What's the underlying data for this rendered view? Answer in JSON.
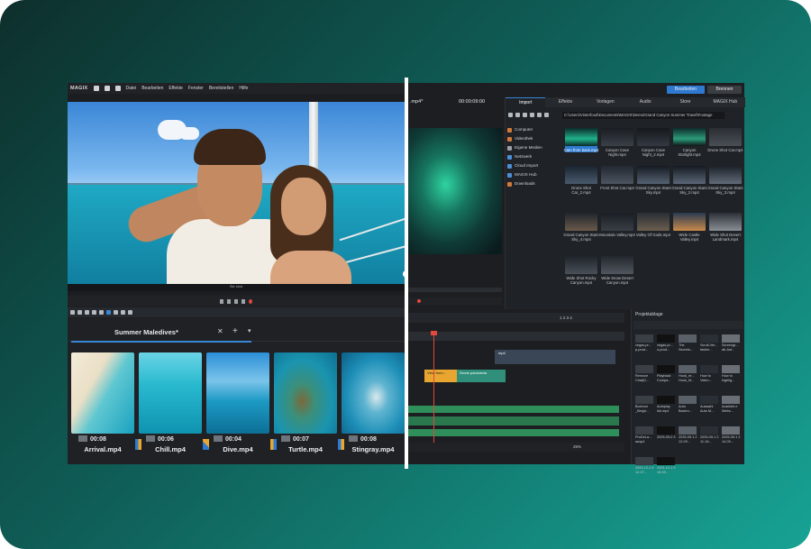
{
  "left": {
    "menu": {
      "logo": "MAGIX",
      "items": [
        "Datei",
        "Bearbeiten",
        "Effekte",
        "Fenster",
        "Bereitstellen",
        "Hilfe"
      ]
    },
    "preview_scrub_label": "Sie sind",
    "storyboard": {
      "title": "Summer Maledives*",
      "close_glyph": "✕",
      "add_glyph": "+",
      "more_glyph": "▾",
      "clips": [
        {
          "duration": "00:08",
          "name": "Arrival.mp4"
        },
        {
          "duration": "00:06",
          "name": "Chill.mp4"
        },
        {
          "duration": "00:04",
          "name": "Dive.mp4"
        },
        {
          "duration": "00:07",
          "name": "Turtle.mp4"
        },
        {
          "duration": "00:08",
          "name": "Stingray.mp4"
        }
      ]
    }
  },
  "right": {
    "buttons": {
      "edit": "Bearbeiten",
      "burn": "Brennen"
    },
    "preview": {
      "star": ".mp4*",
      "timecode": "00:00:09:00"
    },
    "tabs": [
      "Import",
      "Effekte",
      "Vorlagen",
      "Audio",
      "Store",
      "MAGIX Hub"
    ],
    "path": "C:\\Users\\Vinterfood\\Documents\\MAGIX\\Demo\\Grand Canyon Summer Travel\\Footage",
    "sources": [
      "Computer",
      "Videothek",
      "Eigene Medien",
      "Netzwerk",
      "Cloud Import",
      "MAGIX Hub",
      "Downloads"
    ],
    "media_tiles": [
      "Cam from back.mp4",
      "Canyon Cave Night.mp4",
      "Canyon Cave Night_2.mp4",
      "Canyon Starlight.mp4",
      "Drone Shot Car.mp4",
      "Drone Shot Car_2.mp4",
      "Front Shot Car.mp4",
      "Grand Canyon Stars Sky.mp4",
      "Grand Canyon Stars Sky_2.mp4",
      "Grand Canyon Stars Sky_3.mp4",
      "Grand Canyon Stars Sky_4.mp4",
      "Mountain Valley.mp4",
      "Valley Of Gods.mp4",
      "Wide Castle Valley.mp4",
      "Wide Shot Desert Landmark.mp4",
      "Wide Shot Rocky Canyon.mp4",
      "Wide Snow Desert Canyon.mp4"
    ],
    "timeline": {
      "counter": "1 2 3 4",
      "clip_labels": [
        "mp4",
        "View from...",
        "Drone panorama"
      ],
      "zoom": "25%"
    },
    "project": {
      "title": "Projektablage",
      "tiles": [
        "vegas-pr... p-prod...",
        "vegas-pr... o-prod...",
        "The Secrets...",
        "Scroll-Ver... fasher...",
        "Screengr... ab-Aut...",
        "Remove Chat(D...",
        "Playback Compa...",
        "Hook_re... Hook_M...",
        "How to Video...",
        "How to highlig...",
        "Bochum _Beigh...",
        "Autoplay ikb.mp4",
        "Auto Backm...",
        "Auswahl Auto M...",
        "Ausfahrt e Webs...",
        "ProDeLa... ausp4",
        "2025-09-0 3",
        "2025-09-1 2 12-09...",
        "2025-09-1 2 11-16...",
        "2025-09-1 2 14-09...",
        "2024-12-1 9 12-27...",
        "2024-12-1 9 10-09..."
      ]
    }
  },
  "colors": {
    "accent": "#2f7ad0",
    "record": "#e2483c",
    "audio_track": "#2f8f5b",
    "background_gradient": [
      "#0e2f2c",
      "#17a394"
    ]
  }
}
